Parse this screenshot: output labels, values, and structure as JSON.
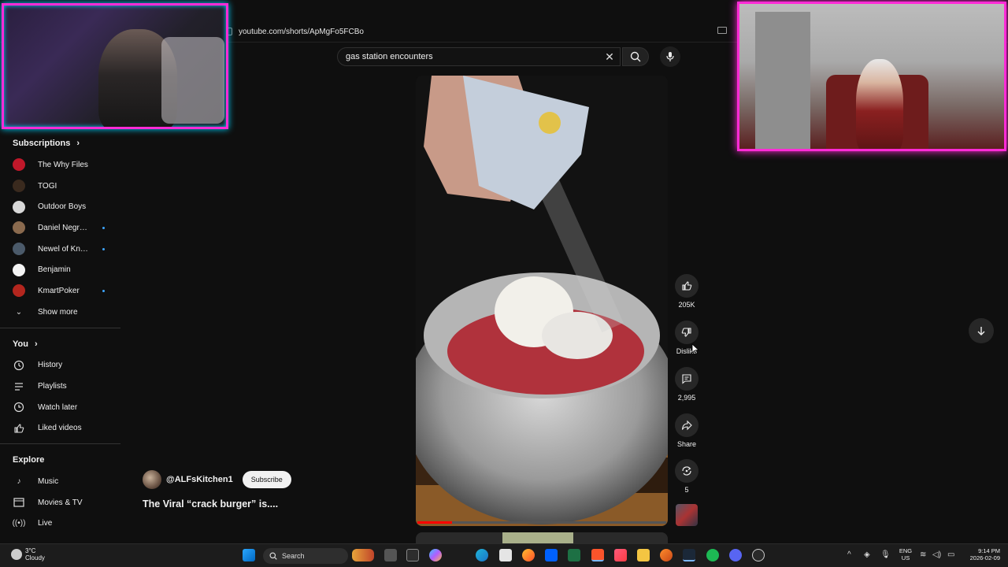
{
  "browser": {
    "url": "youtube.com/shorts/ApMgFo5FCBo"
  },
  "search": {
    "query": "gas station encounters"
  },
  "sidebar": {
    "subscriptions_heading": "Subscriptions",
    "subscriptions": [
      {
        "label": "The Why Files",
        "avatar_color": "#c0182a",
        "new": false
      },
      {
        "label": "TOGI",
        "avatar_color": "#3a2a1e",
        "new": false
      },
      {
        "label": "Outdoor Boys",
        "avatar_color": "#d8d8d8",
        "new": false
      },
      {
        "label": "Daniel Negreanu",
        "avatar_color": "#8a6a4e",
        "new": true
      },
      {
        "label": "Newel of Knowle...",
        "avatar_color": "#4b5a6a",
        "new": true
      },
      {
        "label": "Benjamin",
        "avatar_color": "#f4f4f4",
        "new": false
      },
      {
        "label": "KmartPoker",
        "avatar_color": "#b3261e",
        "new": true
      }
    ],
    "show_more": "Show more",
    "you_heading": "You",
    "you_items": [
      {
        "label": "History",
        "icon": "history-icon"
      },
      {
        "label": "Playlists",
        "icon": "playlists-icon"
      },
      {
        "label": "Watch later",
        "icon": "clock-icon"
      },
      {
        "label": "Liked videos",
        "icon": "thumbs-up-icon"
      }
    ],
    "explore_heading": "Explore",
    "explore_items": [
      {
        "label": "Music",
        "icon": "music-icon"
      },
      {
        "label": "Movies & TV",
        "icon": "movies-icon"
      },
      {
        "label": "Live",
        "icon": "live-icon"
      }
    ]
  },
  "short": {
    "channel_handle": "@ALFsKitchen1",
    "subscribe_label": "Subscribe",
    "title": "The Viral “crack burger” is....",
    "progress": 0.14
  },
  "actions": {
    "likes": "205K",
    "dislike_label": "Dislike",
    "comments": "2,995",
    "share_label": "Share",
    "remix_count": "5"
  },
  "taskbar": {
    "temperature": "3°C",
    "weather": "Cloudy",
    "search_label": "Search",
    "language_top": "ENG",
    "language_bottom": "US",
    "time": "9:14 PM",
    "date": "2026-02-09"
  },
  "colors": {
    "stream_border": "#ff2bd6",
    "stream_glow": "#00d0ff",
    "youtube_bg": "#0f0f0f",
    "progress": "#ff0000"
  }
}
